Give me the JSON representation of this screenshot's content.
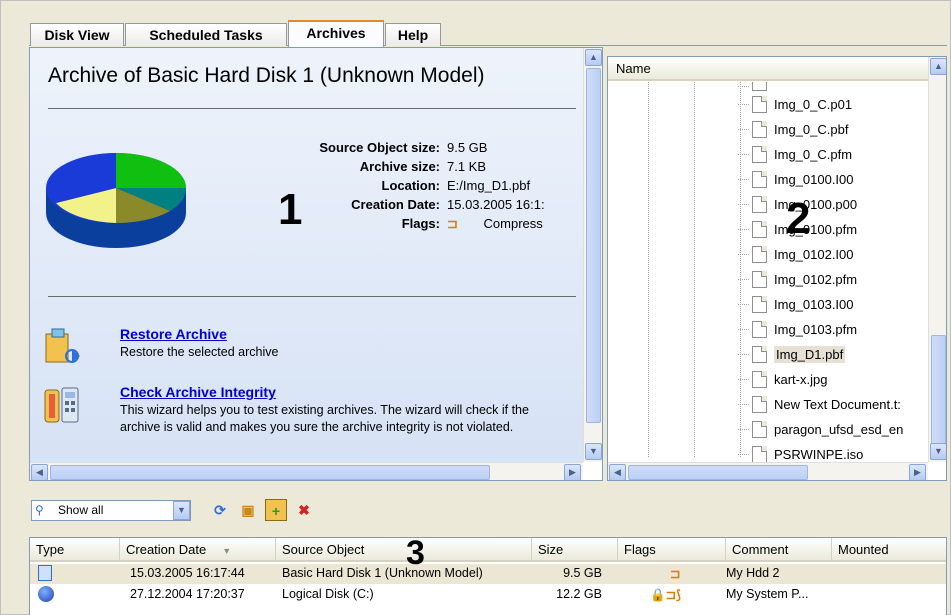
{
  "tabs": [
    {
      "label": "Disk View"
    },
    {
      "label": "Scheduled Tasks"
    },
    {
      "label": "Archives"
    },
    {
      "label": "Help"
    }
  ],
  "active_tab": "Archives",
  "panel1": {
    "title": "Archive of Basic Hard Disk 1 (Unknown Model)",
    "marker": "1",
    "properties": [
      {
        "key": "Source Object size:",
        "value": "9.5 GB"
      },
      {
        "key": "Archive size:",
        "value": "7.1 KB"
      },
      {
        "key": "Location:",
        "value": "E:/Img_D1.pbf"
      },
      {
        "key": "Creation Date:",
        "value": "15.03.2005 16:1:"
      },
      {
        "key": "Flags:",
        "value": "Compress"
      }
    ],
    "actions": [
      {
        "title": "Restore Archive",
        "description": "Restore the selected archive"
      },
      {
        "title": "Check Archive Integrity",
        "description": "This wizard helps you to test existing archives. The wizard will check if the archive is valid and makes you sure the archive integrity is not violated."
      }
    ],
    "pie_colors": [
      "#10c010",
      "#008080",
      "#1b3bd8",
      "#f2f28a",
      "#8a8a2a"
    ]
  },
  "panel2": {
    "header": "Name",
    "marker": "2",
    "files": [
      {
        "name": ""
      },
      {
        "name": "Img_0_C.p01"
      },
      {
        "name": "Img_0_C.pbf"
      },
      {
        "name": "Img_0_C.pfm"
      },
      {
        "name": "Img_0100.I00"
      },
      {
        "name": "Img_0100.p00"
      },
      {
        "name": "Img_0100.pfm"
      },
      {
        "name": "Img_0102.I00"
      },
      {
        "name": "Img_0102.pfm"
      },
      {
        "name": "Img_0103.I00"
      },
      {
        "name": "Img_0103.pfm"
      },
      {
        "name": "Img_D1.pbf"
      },
      {
        "name": "kart-x.jpg"
      },
      {
        "name": "New Text Document.t:"
      },
      {
        "name": "paragon_ufsd_esd_en"
      },
      {
        "name": "PSRWINPE.iso"
      }
    ],
    "selected_file": "Img_D1.pbf"
  },
  "toolbar": {
    "filter_value": "Show all",
    "buttons": [
      "refresh-icon",
      "open-archive-icon",
      "add-archive-icon",
      "delete-archive-icon"
    ]
  },
  "table": {
    "marker": "3",
    "columns": [
      "Type",
      "Creation Date",
      "Source Object",
      "Size",
      "Flags",
      "Comment",
      "Mounted"
    ],
    "rows": [
      {
        "creation_date": "15.03.2005 16:17:44",
        "source": "Basic Hard Disk 1 (Unknown Model)",
        "size": "9.5 GB",
        "flags": "⊐",
        "comment": "My Hdd 2",
        "mounted": ""
      },
      {
        "creation_date": "27.12.2004 17:20:37",
        "source": "Logical Disk (C:)",
        "size": "12.2 GB",
        "flags": "🔒⊐⟆",
        "comment": "My System P...",
        "mounted": ""
      }
    ]
  }
}
